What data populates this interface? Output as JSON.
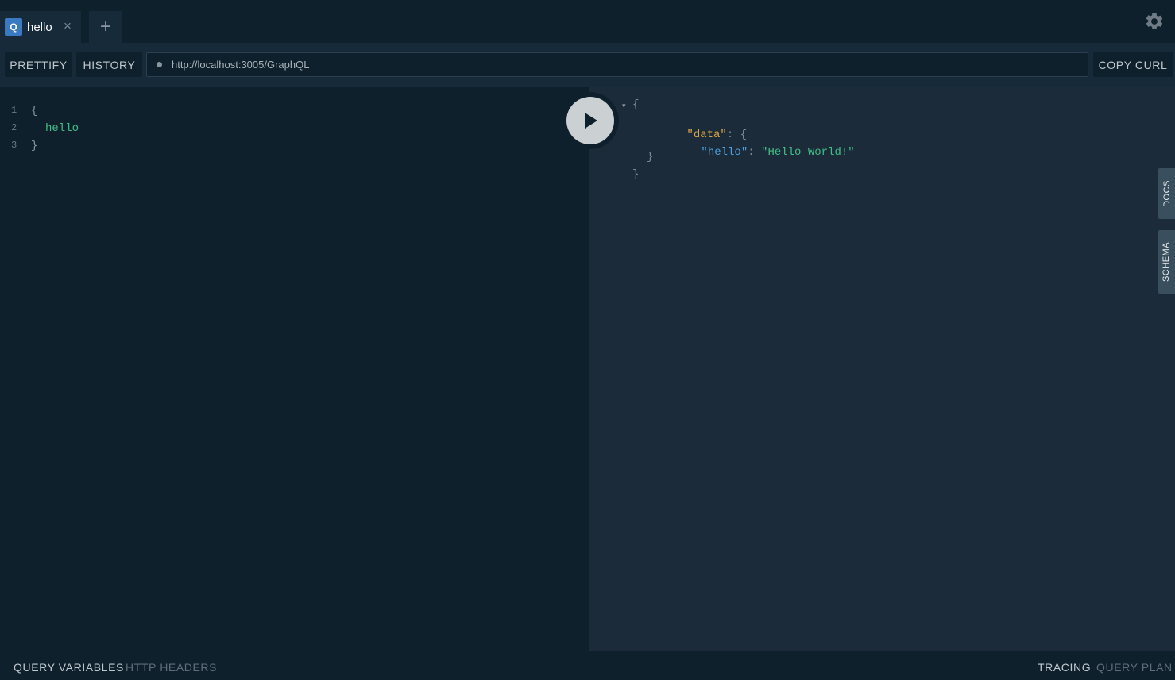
{
  "tabs": [
    {
      "badge": "Q",
      "title": "hello",
      "close_glyph": "×"
    }
  ],
  "add_tab_glyph": "+",
  "icons": {
    "settings": "gear-icon",
    "run": "play-icon",
    "close": "close-icon",
    "add": "plus-icon"
  },
  "toolbar": {
    "prettify_label": "PRETTIFY",
    "history_label": "HISTORY",
    "endpoint_url": "http://localhost:3005/GraphQL",
    "copy_curl_label": "COPY CURL"
  },
  "editor": {
    "lines": [
      {
        "number": "1",
        "text": "{"
      },
      {
        "number": "2",
        "text": "hello"
      },
      {
        "number": "3",
        "text": "}"
      }
    ]
  },
  "result": {
    "collapse_glyph": "▾",
    "open_brace": "{",
    "data_key": "\"data\"",
    "colon": ": {",
    "hello_key": "\"hello\"",
    "colon2": ": ",
    "hello_value": "\"Hello World!\"",
    "inner_close": "}",
    "outer_close": "}"
  },
  "side_tabs": {
    "docs": "DOCS",
    "schema": "SCHEMA"
  },
  "bottom": {
    "query_variables": "QUERY VARIABLES",
    "http_headers": "HTTP HEADERS",
    "tracing": "TRACING",
    "query_plan": "QUERY PLAN"
  },
  "colors": {
    "background": "#172a3a",
    "editor_bg": "#0f202d",
    "field_green": "#3fbf86",
    "key_orange": "#d7a642",
    "key_blue": "#4e9fdc",
    "badge_blue": "#3a7ac2"
  }
}
